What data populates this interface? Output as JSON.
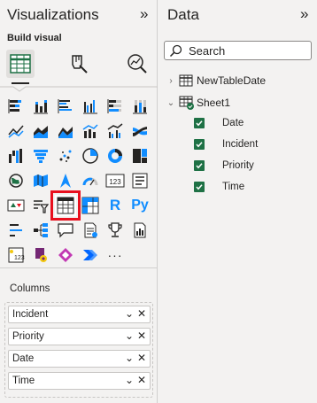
{
  "viz": {
    "title": "Visualizations",
    "collapse_glyph": "»",
    "build_label": "Build visual",
    "columns_label": "Columns",
    "wells": [
      {
        "label": "Incident"
      },
      {
        "label": "Priority"
      },
      {
        "label": "Date"
      },
      {
        "label": "Time"
      }
    ],
    "icon_r": "R",
    "icon_py": "Py",
    "icon_more": "···",
    "icon_123": "123",
    "highlight_color": "#e8101e"
  },
  "data": {
    "title": "Data",
    "collapse_glyph": "»",
    "search_placeholder": "Search",
    "tables": [
      {
        "name": "NewTableDate",
        "expanded": false
      },
      {
        "name": "Sheet1",
        "expanded": true
      }
    ],
    "fields": [
      {
        "label": "Date",
        "checked": true
      },
      {
        "label": "Incident",
        "checked": true
      },
      {
        "label": "Priority",
        "checked": true
      },
      {
        "label": "Time",
        "checked": true
      }
    ],
    "check_color": "#1e7145"
  }
}
